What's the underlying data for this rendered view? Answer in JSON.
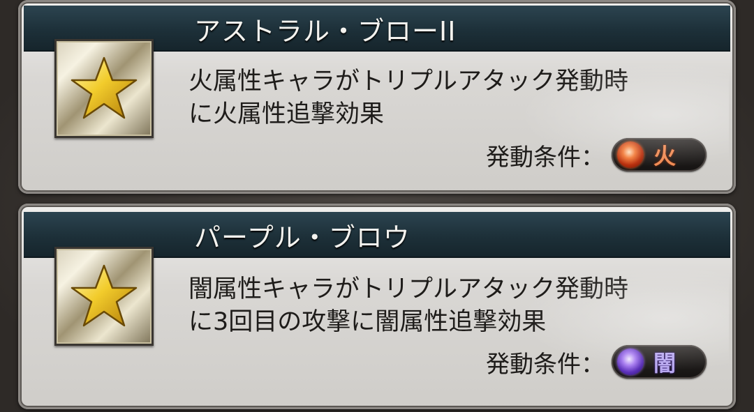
{
  "skills": [
    {
      "name": "アストラル・ブローII",
      "description_line1": "火属性キャラがトリプルアタック発動時",
      "description_line2": "に火属性追撃効果",
      "condition_label": "発動条件：",
      "element": {
        "name": "火",
        "icon": "fire-element-icon",
        "color": "#f08a52"
      }
    },
    {
      "name": "パープル・ブロウ",
      "description_line1": "闇属性キャラがトリプルアタック発動時",
      "description_line2": "に3回目の攻撃に闇属性追撃効果",
      "condition_label": "発動条件：",
      "element": {
        "name": "闇",
        "icon": "dark-element-icon",
        "color": "#b8a8f0"
      }
    }
  ],
  "icons": {
    "skill_icon": "gold-star-icon"
  }
}
